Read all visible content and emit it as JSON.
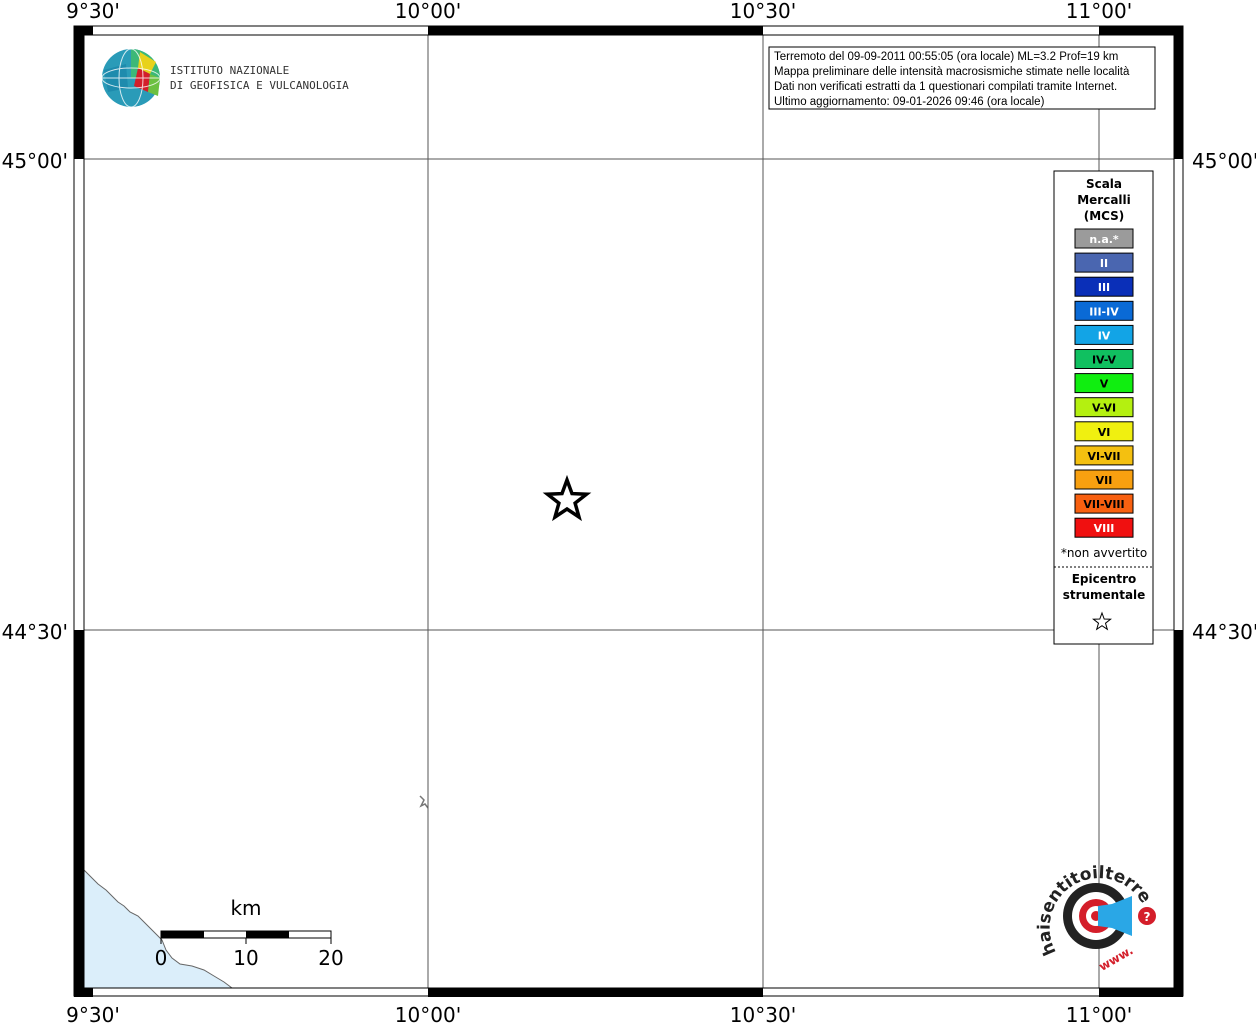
{
  "map": {
    "lon_labels": [
      "9°30'",
      "10°00'",
      "10°30'",
      "11°00'"
    ],
    "lat_labels": [
      "45°00'",
      "44°30'"
    ]
  },
  "info_box": {
    "lines": [
      "Terremoto del 09-09-2011 00:55:05 (ora locale) ML=3.2 Prof=19 km",
      "Mappa preliminare delle intensità macrosismiche stimate nelle località",
      "Dati non verificati estratti da 1 questionari compilati tramite Internet.",
      "Ultimo aggiornamento: 09-01-2026 09:46 (ora locale)"
    ]
  },
  "institute": {
    "line1": "ISTITUTO NAZIONALE",
    "line2": "DI GEOFISICA E VULCANOLOGIA"
  },
  "legend": {
    "title_lines": [
      "Scala",
      "Mercalli",
      "(MCS)"
    ],
    "items": [
      {
        "label": "n.a.*",
        "color": "#9b9b9b",
        "text_color": "#ffffff"
      },
      {
        "label": "II",
        "color": "#4a66b0",
        "text_color": "#ffffff"
      },
      {
        "label": "III",
        "color": "#0a2fb8",
        "text_color": "#ffffff"
      },
      {
        "label": "III-IV",
        "color": "#0a6ad6",
        "text_color": "#ffffff"
      },
      {
        "label": "IV",
        "color": "#12a4e6",
        "text_color": "#ffffff"
      },
      {
        "label": "IV-V",
        "color": "#10c060",
        "text_color": "#000000"
      },
      {
        "label": "V",
        "color": "#10ee10",
        "text_color": "#000000"
      },
      {
        "label": "V-VI",
        "color": "#b4f010",
        "text_color": "#000000"
      },
      {
        "label": "VI",
        "color": "#f0f010",
        "text_color": "#000000"
      },
      {
        "label": "VI-VII",
        "color": "#f4c010",
        "text_color": "#000000"
      },
      {
        "label": "VII",
        "color": "#f8a010",
        "text_color": "#000000"
      },
      {
        "label": "VII-VIII",
        "color": "#f86010",
        "text_color": "#000000"
      },
      {
        "label": "VIII",
        "color": "#f01010",
        "text_color": "#ffffff"
      }
    ],
    "footnote": "*non avvertito",
    "epicenter_lines": [
      "Epicentro",
      "strumentale"
    ]
  },
  "scale_bar": {
    "unit": "km",
    "ticks": [
      "0",
      "10",
      "20"
    ]
  },
  "hst_logo": {
    "arc_text": "haisentitoilterremoto.it",
    "domain": "www."
  }
}
